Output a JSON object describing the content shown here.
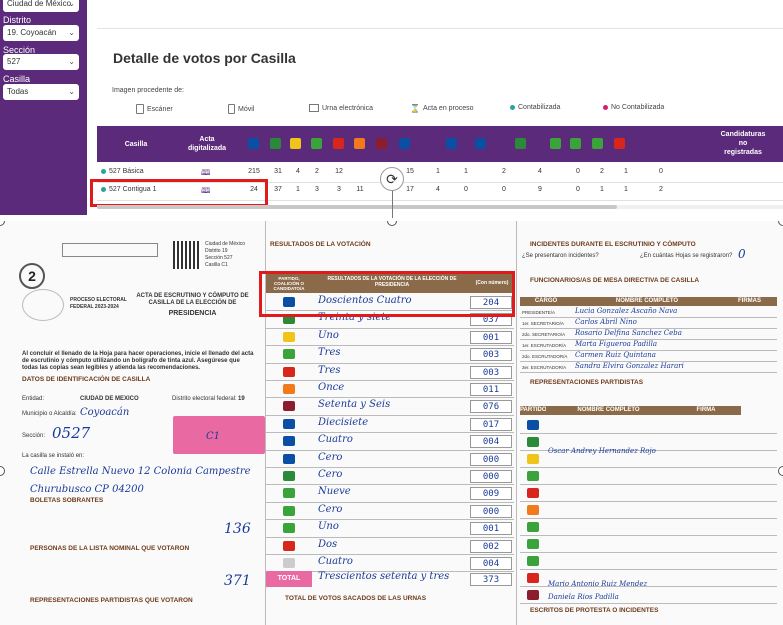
{
  "sidebar": {
    "top_value": "Ciudad de México",
    "district_label": "Distrito",
    "district_value": "19. Coyoacán",
    "section_label": "Sección",
    "section_value": "527",
    "casilla_label": "Casilla",
    "casilla_value": "Todas"
  },
  "main": {
    "title": "Detalle de votos por Casilla",
    "source_label": "Imagen procedente de:",
    "sources": [
      "Escáner",
      "Móvil",
      "Urna electrónica",
      "Acta en proceso"
    ],
    "status": [
      {
        "label": "Contabilizada",
        "color": "#27a59a"
      },
      {
        "label": "No Contabilizada",
        "color": "#d6206f"
      }
    ]
  },
  "table": {
    "col_casilla": "Casilla",
    "col_acta": "Acta digitalizada",
    "col_cand": "Candidaturas no registradas",
    "party_logos": [
      {
        "name": "PAN",
        "color": "#0a4fa3"
      },
      {
        "name": "PRI",
        "color": "#2a8a3a"
      },
      {
        "name": "PRD",
        "color": "#f0c419"
      },
      {
        "name": "PVEM",
        "color": "#3aa33a"
      },
      {
        "name": "PT",
        "color": "#d9261c"
      },
      {
        "name": "MC",
        "color": "#f27a1a"
      },
      {
        "name": "MORENA",
        "color": "#8c1d2e"
      },
      {
        "name": "PAN-PRI-PRD",
        "color": "#0a4fa3"
      },
      {
        "name": "PAN-PRI",
        "color": "#0a4fa3"
      },
      {
        "name": "PAN-PRD",
        "color": "#0a4fa3"
      },
      {
        "name": "PRI-PRD",
        "color": "#2a8a3a"
      },
      {
        "name": "PVEM-PT-MORENA",
        "color": "#3aa33a"
      },
      {
        "name": "PVEM-PT",
        "color": "#3aa33a"
      },
      {
        "name": "PVEM-MORENA",
        "color": "#3aa33a"
      },
      {
        "name": "PT-MORENA",
        "color": "#d9261c"
      }
    ],
    "rows": [
      {
        "status_color": "#27a59a",
        "casilla": "527 Básica",
        "values": [
          "215",
          "31",
          "4",
          "2",
          "12",
          "",
          "",
          "15",
          "1",
          "1",
          "2",
          "4",
          "0",
          "2",
          "1",
          "0"
        ]
      },
      {
        "status_color": "#27a59a",
        "casilla": "527 Contigua 1",
        "values": [
          "24",
          "37",
          "1",
          "3",
          "3",
          "11",
          "",
          "17",
          "4",
          "0",
          "0",
          "9",
          "0",
          "1",
          "1",
          "2"
        ]
      }
    ]
  },
  "document": {
    "acta_number": "2",
    "acta_title": "ACTA DE ESCRUTINIO Y CÓMPUTO DE CASILLA DE LA ELECCIÓN DE",
    "acta_subtitle": "PRESIDENCIA",
    "proceso": "PROCESO ELECTORAL FEDERAL 2023-2024",
    "qr_meta": [
      "Ciudad de México",
      "Distrito 19",
      "Sección 527",
      "Casilla C1"
    ],
    "instruction": "Al concluir el llenado de la Hoja para hacer operaciones, inicie el llenado del acta de escrutinio y cómputo utilizando un bolígrafo de tinta azul. Asegúrese que todas las copias sean legibles y atienda las recomendaciones.",
    "sec1": "DATOS DE IDENTIFICACIÓN DE CASILLA",
    "entidad_label": "Entidad:",
    "entidad_value": "CIUDAD DE MEXICO",
    "distrito_label": "Distrito electoral federal:",
    "distrito_value": "19",
    "municipio_label": "Municipio o Alcaldía:",
    "municipio_value": "Coyoacán",
    "seccion_label": "Sección:",
    "seccion_value": "0527",
    "tipo_value": "C1",
    "instalada_label": "La casilla se instaló en:",
    "direccion": "Calle Estrella Nuevo 12 Colonia Campestre Churubusco CP 04200",
    "sec2": "BOLETAS SOBRANTES",
    "boletas_value": "136",
    "sec3": "PERSONAS DE LA LISTA NOMINAL QUE VOTARON",
    "personas_value": "371",
    "sec4": "REPRESENTACIONES PARTIDISTAS QUE VOTARON",
    "results_head": "RESULTADOS DE LA VOTACIÓN",
    "results_cols": [
      "PARTIDO, COALICIÓN O CANDIDATO/A",
      "RESULTADOS DE LA VOTACIÓN DE LA ELECCIÓN DE PRESIDENCIA",
      "(Con número)"
    ],
    "results": [
      {
        "words": "Doscientos Cuatro",
        "number": "204"
      },
      {
        "words": "Treinta y siete",
        "number": "037"
      },
      {
        "words": "Uno",
        "number": "001"
      },
      {
        "words": "Tres",
        "number": "003"
      },
      {
        "words": "Tres",
        "number": "003"
      },
      {
        "words": "Once",
        "number": "011"
      },
      {
        "words": "Setenta y Seis",
        "number": "076"
      },
      {
        "words": "Diecisiete",
        "number": "017"
      },
      {
        "words": "Cuatro",
        "number": "004"
      },
      {
        "words": "Cero",
        "number": "000"
      },
      {
        "words": "Cero",
        "number": "000"
      },
      {
        "words": "Nueve",
        "number": "009"
      },
      {
        "words": "Cero",
        "number": "000"
      },
      {
        "words": "Uno",
        "number": "001"
      },
      {
        "words": "Dos",
        "number": "002"
      },
      {
        "words": "Cuatro",
        "number": "004"
      }
    ],
    "total_label": "TOTAL",
    "total_words": "Trescientos setenta y tres",
    "total_number": "373",
    "sec_total_votos": "TOTAL DE VOTOS SACADOS DE LAS URNAS",
    "incidentes": "INCIDENTES DURANTE EL ESCRUTINIO Y CÓMPUTO",
    "incidentes_q": "¿Se presentaron incidentes?",
    "hojas_q": "¿En cuántas Hojas se registraron?",
    "hojas_value": "0",
    "funcionarios": "FUNCIONARIOS/AS DE MESA DIRECTIVA DE CASILLA",
    "func_cols": [
      "CARGO",
      "NOMBRE COMPLETO",
      "FIRMAS"
    ],
    "func_rows": [
      {
        "cargo": "PRESIDENTE/A",
        "nombre": "Lucia Gonzalez Ascaño Nava"
      },
      {
        "cargo": "1er. SECRETARIO/A",
        "nombre": "Carlos Abril Nino"
      },
      {
        "cargo": "2do. SECRETARIO/A",
        "nombre": "Rosario Delfina Sanchez Ceba"
      },
      {
        "cargo": "1er. ESCRUTADOR/A",
        "nombre": "Marta Figueroa Padilla"
      },
      {
        "cargo": "2do. ESCRUTADOR/A",
        "nombre": "Carmen Ruiz Quintana"
      },
      {
        "cargo": "3er. ESCRUTADOR/A",
        "nombre": "Sandra Elvira Gonzalez Harari"
      }
    ],
    "representaciones": "REPRESENTACIONES PARTIDISTAS",
    "rep_cols": [
      "PARTIDO",
      "NOMBRE COMPLETO",
      "FIRMA"
    ],
    "rep_names": [
      "Oscar Andrey Hernandez Rojo",
      "Mario Antonio Ruiz Mendez",
      "Daniela Rios Padilla"
    ],
    "escritos": "ESCRITOS DE PROTESTA O INCIDENTES"
  }
}
